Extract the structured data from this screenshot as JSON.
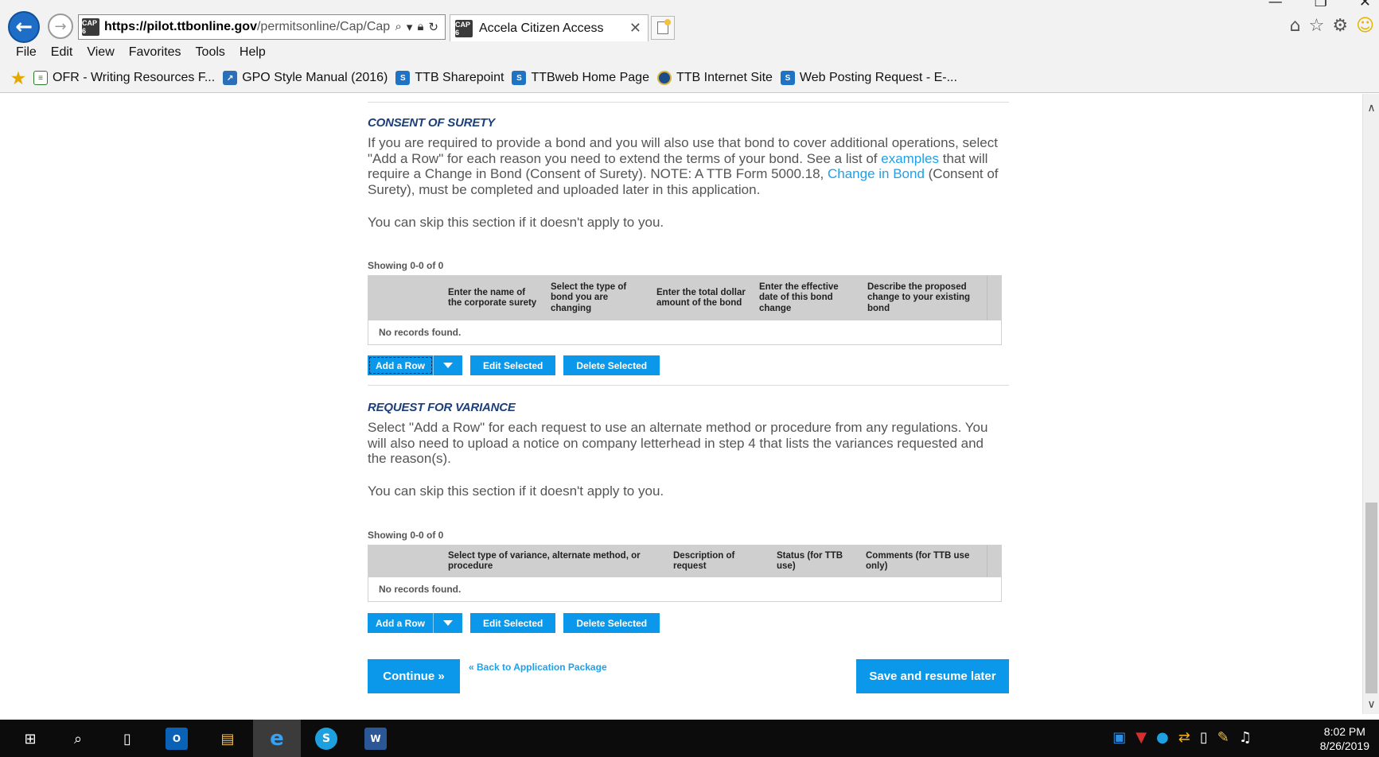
{
  "browser": {
    "url_domain": "https://pilot.ttbonline.gov",
    "url_rest": "/permitsonline/Cap/Cap",
    "tab_title": "Accela Citizen Access",
    "favicon_text": "CAP 6",
    "menu": [
      "File",
      "Edit",
      "View",
      "Favorites",
      "Tools",
      "Help"
    ],
    "favorites": [
      {
        "label": "OFR - Writing Resources F...",
        "icon": "doc-icon"
      },
      {
        "label": "GPO Style Manual (2016)",
        "icon": "gpo-icon"
      },
      {
        "label": "TTB Sharepoint",
        "icon": "sharepoint-icon"
      },
      {
        "label": "TTBweb Home Page",
        "icon": "sharepoint-icon"
      },
      {
        "label": "TTB Internet Site",
        "icon": "ttb-seal-icon"
      },
      {
        "label": "Web Posting Request - E-...",
        "icon": "sharepoint-icon"
      }
    ]
  },
  "consent": {
    "title": "CONSENT OF SURETY",
    "p1_a": "If you are required to provide a bond and you will also use that bond to cover additional operations, select \"Add a Row\" for each reason you need to extend the terms of your bond. See a list of ",
    "p1_link1": "examples",
    "p1_b": " that will require a Change in Bond (Consent of Surety). NOTE: A TTB Form 5000.18, ",
    "p1_link2": "Change in Bond",
    "p1_c": " (Consent of Surety), must be completed and uploaded later in this application.",
    "p2": "You can skip this section if it doesn't apply to you.",
    "showing": "Showing 0-0 of 0",
    "columns": [
      "Enter the name of the corporate surety",
      "Select the type of bond you are changing",
      "Enter the total dollar amount of the bond",
      "Enter the effective date of this bond change",
      "Describe the proposed change to your existing bond"
    ],
    "empty": "No records found."
  },
  "variance": {
    "title": "REQUEST FOR VARIANCE",
    "p1": "Select \"Add a Row\" for each request to use an alternate method or procedure from any regulations. You will also need to upload a notice on company letterhead in step 4 that lists the variances requested and the reason(s).",
    "p2": "You can skip this section if it doesn't apply to you.",
    "showing": "Showing 0-0 of 0",
    "columns": [
      "Select type of variance, alternate method, or procedure",
      "Description of request",
      "Status (for TTB use)",
      "Comments (for TTB use only)"
    ],
    "empty": "No records found."
  },
  "buttons": {
    "add_row": "Add a Row",
    "edit_selected": "Edit Selected",
    "delete_selected": "Delete Selected",
    "continue": "Continue »",
    "back_link": "« Back to Application Package",
    "save_resume": "Save and resume later"
  },
  "taskbar": {
    "time": "8:02 PM",
    "date": "8/26/2019"
  },
  "colors": {
    "accent": "#0b98ea",
    "section_title": "#1b3f7a",
    "link": "#20a0e8"
  }
}
